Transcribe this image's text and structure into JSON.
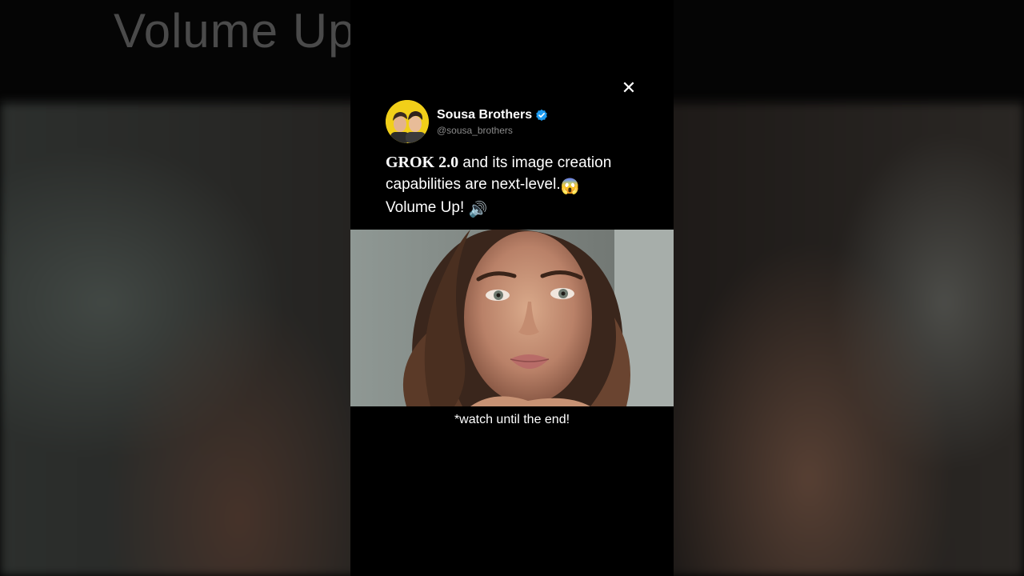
{
  "background": {
    "top_text": "Volume Up"
  },
  "close": {
    "label": "✕"
  },
  "tweet": {
    "author_name": "Sousa Brothers",
    "handle": "@sousa_brothers",
    "verified": true,
    "brand_text": "GROK 2.0",
    "text_line_1": " and its image creation capabilities are next-level.",
    "emoji_1": "😱",
    "text_line_2": "Volume Up! ",
    "emoji_2": "🔊"
  },
  "caption": "*watch until the end!",
  "colors": {
    "verified_badge": "#1d9bf0",
    "avatar_bg": "#f1cf19",
    "panel_bg": "#000000",
    "handle_text": "#8b8b8b"
  }
}
